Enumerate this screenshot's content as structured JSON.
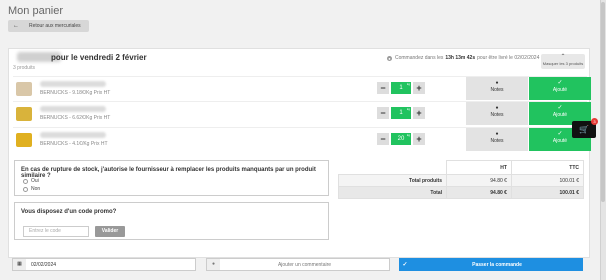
{
  "page": {
    "title": "Mon panier"
  },
  "back_button": {
    "label": "Retour aux mercuriales"
  },
  "order": {
    "delivery_title": "pour le vendredi 2 février",
    "product_count": "3 produits",
    "cutoff_prefix": "Commandez dans les",
    "cutoff_time": "13h 13m 42s",
    "cutoff_suffix": "pour être livré le 02/02/2024",
    "hide_label": "Masquer les 3 produits"
  },
  "products": [
    {
      "meta": "BERNUCKS - 9.18€/Kg Prix HT",
      "quantity": "1",
      "unit": "kg",
      "image_color": "#d9c7a8"
    },
    {
      "meta": "BERNUCKS - 6.62€/Kg Prix HT",
      "quantity": "1",
      "unit": "kg",
      "image_color": "#d9b33b"
    },
    {
      "meta": "BERNUCKS - 4.1€/Kg Prix HT",
      "quantity": "20",
      "unit": "kg",
      "image_color": "#e0b020"
    }
  ],
  "row_actions": {
    "notes_label": "Notes",
    "added_label": "Ajouté"
  },
  "cart": {
    "count": "3"
  },
  "stockout": {
    "question": "En cas de rupture de stock, j'autorise le fournisseur à remplacer les produits manquants par un produit similaire ?",
    "option_yes": "Oui",
    "option_no": "Non"
  },
  "promo": {
    "question": "Vous disposez d'un code promo?",
    "placeholder": "Entrez le code",
    "validate_label": "Valider"
  },
  "totals": {
    "header_ht": "HT",
    "header_ttc": "TTC",
    "rows": [
      {
        "label": "Total produits",
        "ht": "94.80 €",
        "ttc": "100.01 €"
      },
      {
        "label": "Total",
        "ht": "94.80 €",
        "ttc": "100.01 €"
      }
    ]
  },
  "footer": {
    "date": "02/02/2024",
    "comment_placeholder": "Ajouter un commentaire",
    "order_button": "Passer la commande"
  },
  "colors": {
    "accent_green": "#21c35f",
    "accent_blue": "#1e8fe1",
    "badge_red": "#e53935"
  }
}
